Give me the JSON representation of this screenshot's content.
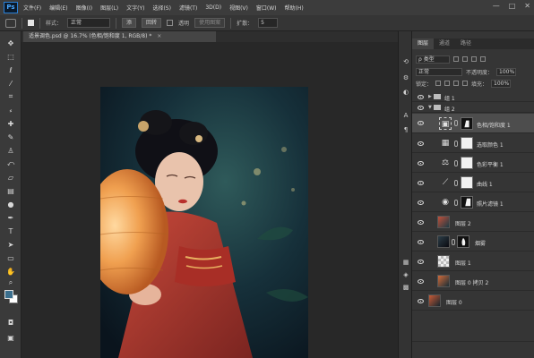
{
  "app": {
    "logo": "Ps"
  },
  "menu": [
    "文件(F)",
    "编辑(E)",
    "图像(I)",
    "图层(L)",
    "文字(Y)",
    "选择(S)",
    "滤镜(T)",
    "3D(D)",
    "视图(V)",
    "窗口(W)",
    "帮助(H)"
  ],
  "window_controls": {
    "minimize": "—",
    "maximize": "□",
    "close": "✕"
  },
  "options": {
    "style_label": "样式：",
    "style_value": "正常",
    "add_button": "添",
    "subtract_button": "回转",
    "transparent_label": "透明",
    "pattern_button": "使用图案",
    "diffusion_label": "扩散：",
    "diffusion_value": "5"
  },
  "document": {
    "tab_title": "适景调色.psd @ 16.7% (色相/饱和度 1, RGB/8) *",
    "tab_close": "×"
  },
  "layers_panel": {
    "tabs": [
      "图层",
      "通道",
      "路径"
    ],
    "filter_label": "ρ 类型",
    "blend_mode": "正常",
    "opacity_label": "不透明度：",
    "opacity_value": "100%",
    "lock_label": "锁定：",
    "fill_label": "填充：",
    "fill_value": "100%",
    "layers": [
      {
        "name": "组 1",
        "type": "group"
      },
      {
        "name": "组 2",
        "type": "group"
      },
      {
        "name": "色相/饱和度 1",
        "type": "adjustment",
        "icon": "hue-saturation-icon",
        "selected": true
      },
      {
        "name": "选取颜色 1",
        "type": "adjustment",
        "icon": "selective-color-icon"
      },
      {
        "name": "色彩平衡 1",
        "type": "adjustment",
        "icon": "color-balance-icon"
      },
      {
        "name": "曲线 1",
        "type": "adjustment",
        "icon": "curves-icon"
      },
      {
        "name": "照片滤镜 1",
        "type": "adjustment",
        "icon": "photo-filter-icon"
      },
      {
        "name": "图层 2",
        "type": "pixel"
      },
      {
        "name": "烟雾",
        "type": "pixel-mask"
      },
      {
        "name": "图层 1",
        "type": "transparent"
      },
      {
        "name": "图层 0 拷贝 2",
        "type": "pixel"
      },
      {
        "name": "图层 0",
        "type": "pixel"
      }
    ]
  },
  "colors": {
    "foreground": "#3b6f8e",
    "background": "#ffffff",
    "selected_layer": "#4d4d4d",
    "panel": "#353535",
    "canvas": "#282828"
  }
}
